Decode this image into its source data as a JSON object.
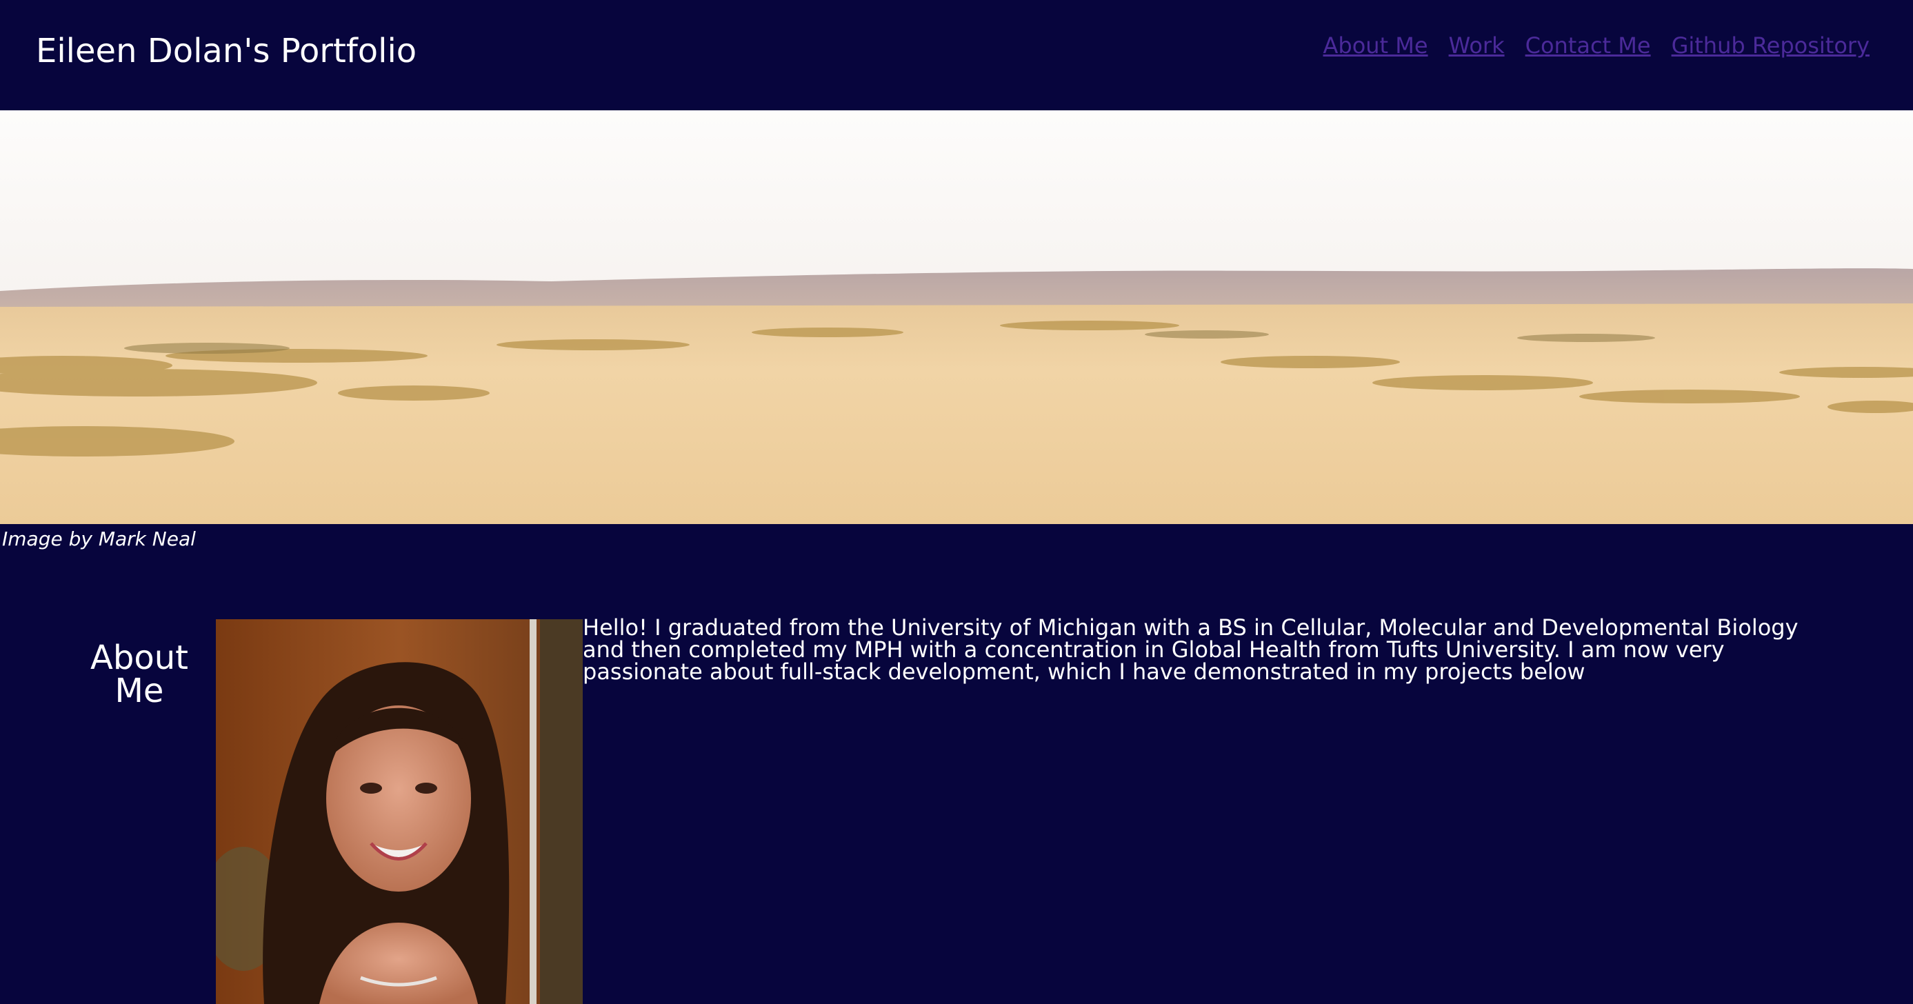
{
  "header": {
    "title": "Eileen Dolan's Portfolio",
    "nav": [
      {
        "label": "About Me"
      },
      {
        "label": "Work"
      },
      {
        "label": "Contact Me"
      },
      {
        "label": "Github Repository"
      }
    ]
  },
  "hero": {
    "caption": "Image by Mark Neal"
  },
  "about": {
    "heading": "About Me",
    "text": "Hello! I graduated from the University of Michigan with a BS in Cellular, Molecular and Developmental Biology and then completed my MPH with a concentration in Global Health from Tufts University. I am now very passionate about full-stack development, which I have demonstrated in my projects below"
  },
  "colors": {
    "background": "#07053d",
    "link": "#4b2a9a",
    "text": "#ffffff"
  }
}
